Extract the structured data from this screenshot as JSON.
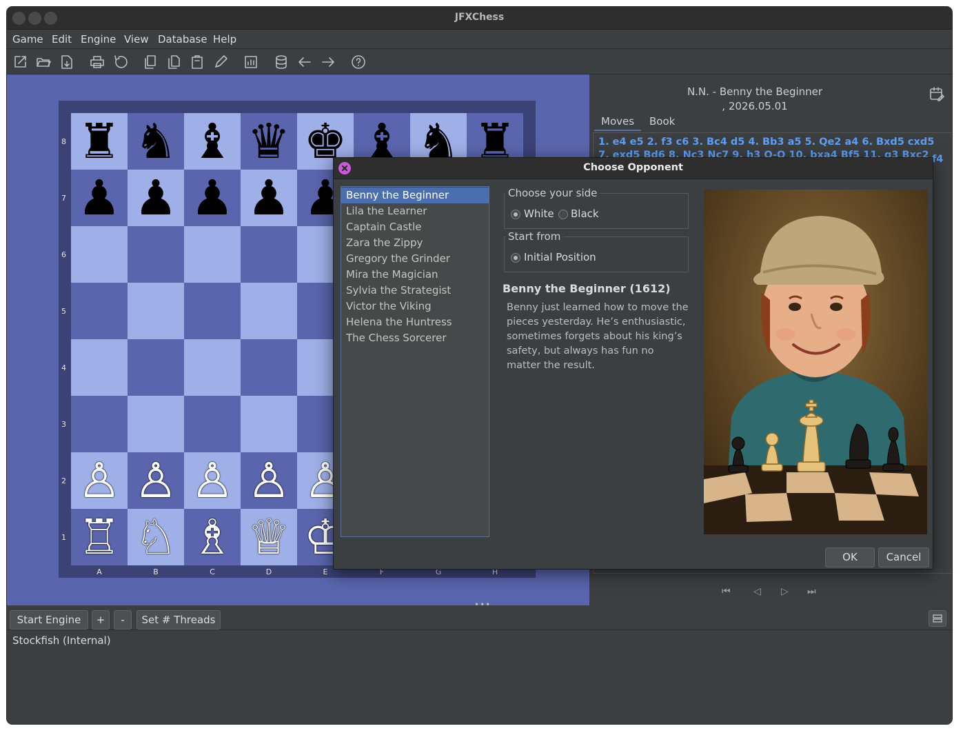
{
  "window": {
    "title": "JFXChess"
  },
  "menu": [
    "Game",
    "Edit",
    "Engine",
    "View",
    "Database",
    "Help"
  ],
  "toolbar": {
    "icons": [
      "new-game-icon",
      "open-file-icon",
      "save-file-icon",
      "print-icon",
      "flip-board-icon",
      "copy-game-icon",
      "copy-position-icon",
      "paste-icon",
      "edit-icon",
      "analyze-icon",
      "database-icon",
      "back-icon",
      "forward-icon",
      "help-icon"
    ]
  },
  "board": {
    "ranks": [
      "8",
      "7",
      "6",
      "5",
      "4",
      "3",
      "2",
      "1"
    ],
    "files": [
      "A",
      "B",
      "C",
      "D",
      "E",
      "F",
      "G",
      "H"
    ],
    "rows": [
      [
        "♜",
        "♞",
        "♝",
        "♛",
        "♚",
        "♝",
        "♞",
        "♜"
      ],
      [
        "♟",
        "♟",
        "♟",
        "♟",
        "♟",
        "♟",
        "♟",
        "♟"
      ],
      [
        "",
        "",
        "",
        "",
        "",
        "",
        "",
        ""
      ],
      [
        "",
        "",
        "",
        "",
        "",
        "",
        "",
        ""
      ],
      [
        "",
        "",
        "",
        "",
        "",
        "",
        "",
        ""
      ],
      [
        "",
        "",
        "",
        "",
        "",
        "",
        "",
        ""
      ],
      [
        "♙",
        "♙",
        "♙",
        "♙",
        "♙",
        "♙",
        "♙",
        "♙"
      ],
      [
        "♖",
        "♘",
        "♗",
        "♕",
        "♔",
        "♗",
        "♘",
        "♖"
      ]
    ],
    "colors": {
      "light": "#9fb0e8",
      "dark": "#5a65ad"
    }
  },
  "game": {
    "header_line1": "N.N. - Benny the Beginner",
    "header_line2": ", 2026.05.01",
    "tabs": [
      "Moves",
      "Book"
    ],
    "moves": "1. e4 e5 2. f3 c6 3. Bc4 d5 4. Bb3 a5 5. Qe2 a4 6. Bxd5 cxd5 7. exd5 Bd6 8. Nc3 Nc7 9. h3 O-O 10. bxa4 Bf5 11. g3 Bxc2 12. d3 Bxa4 13.",
    "move_tail": "f4"
  },
  "navigation": {
    "first": "⏮",
    "prev": "◁",
    "next": "▷",
    "last": "⏭"
  },
  "engine": {
    "start_label": "Start Engine",
    "plus_label": "+",
    "minus_label": "-",
    "threads_label": "Set # Threads",
    "engine_name": "Stockfish (Internal)"
  },
  "dialog": {
    "title": "Choose Opponent",
    "opponents": [
      "Benny the Beginner",
      "Lila the Learner",
      "Captain Castle",
      "Zara the Zippy",
      "Gregory the Grinder",
      "Mira the Magician",
      "Sylvia the Strategist",
      "Victor the Viking",
      "Helena the Huntress",
      "The Chess Sorcerer"
    ],
    "selected_index": 0,
    "side_label": "Choose your side",
    "white_label": "White",
    "black_label": "Black",
    "side_selected": "White",
    "start_label": "Start from",
    "initial_label": "Initial Position",
    "opponent_name": "Benny the Beginner (1612)",
    "opponent_desc": "Benny just learned how to move the pieces yesterday. He’s enthusiastic, sometimes forgets about his king’s safety, but always has fun no matter the result.",
    "ok_label": "OK",
    "cancel_label": "Cancel"
  }
}
